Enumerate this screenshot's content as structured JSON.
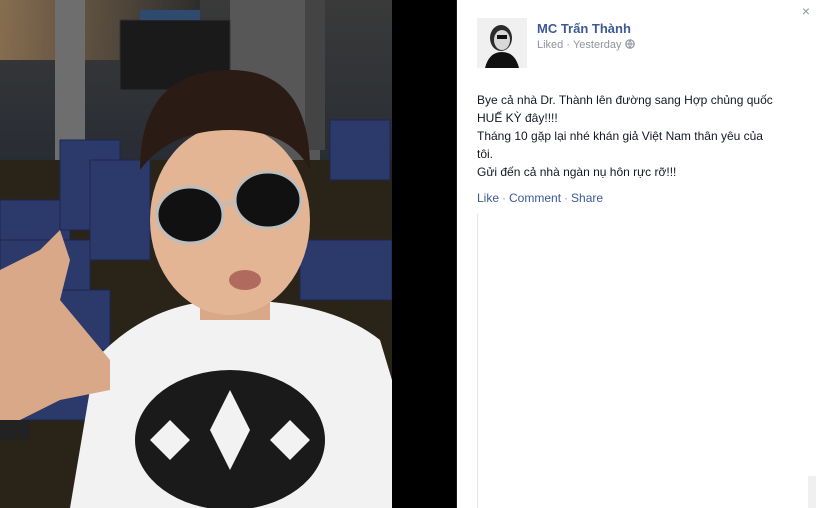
{
  "photo": {
    "description_icon": "selfie-photo"
  },
  "panel": {
    "close_label": "×",
    "author": "MC Trấn Thành",
    "status": "Liked",
    "separator": "·",
    "time": "Yesterday",
    "privacy_icon": "globe-icon",
    "post_lines": [
      "Bye cả nhà Dr. Thành lên đường sang Hợp chủng quốc HUẾ KỲ đây!!!!",
      "Tháng 10 gặp lại nhé khán giả Việt Nam thân yêu của tôi.",
      "Gửi đến cả nhà ngàn nụ hôn rực rỡ!!!"
    ],
    "actions": {
      "like": "Like",
      "comment": "Comment",
      "share": "Share",
      "sep": "·"
    },
    "colors": {
      "link": "#3b5998",
      "meta": "#90949c",
      "text": "#141823"
    }
  }
}
